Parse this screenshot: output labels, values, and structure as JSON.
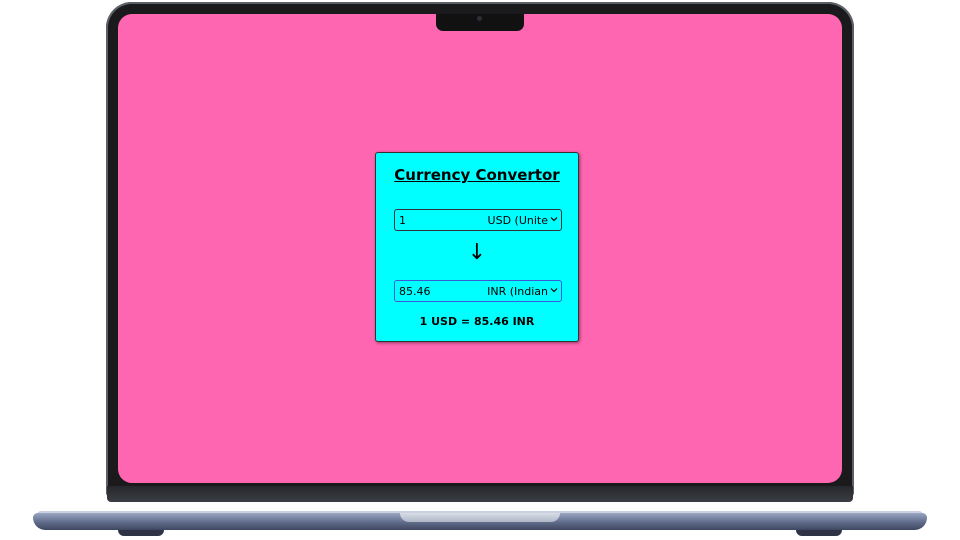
{
  "converter": {
    "title": "Currency Convertor",
    "from": {
      "amount": "1",
      "currency": "USD (United States Dollar)",
      "currency_visible": "USD (Unite"
    },
    "arrow": "↓",
    "to": {
      "amount": "85.46",
      "currency": "INR (Indian Rupee)",
      "currency_visible": "INR (Indian"
    },
    "result": "1 USD = 85.46 INR"
  },
  "icons": {
    "dropdown": "chevron-down-icon",
    "convert_direction": "arrow-down-icon"
  },
  "colors": {
    "background": "#ff66b2",
    "card": "#00ffff",
    "to_field_border": "#3b5bd6"
  }
}
